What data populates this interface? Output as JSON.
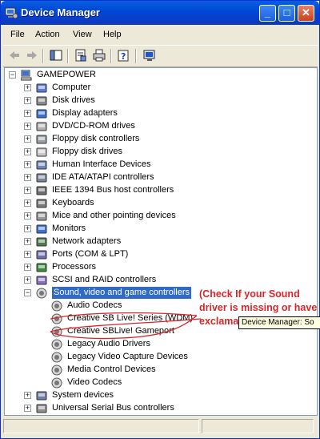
{
  "window": {
    "title": "Device Manager",
    "controls": [
      "_",
      "□",
      "✕"
    ]
  },
  "menu": [
    "File",
    "Action",
    "View",
    "Help"
  ],
  "toolbar": {
    "icons": [
      "back-icon",
      "forward-icon",
      "show-hide-console-tree-icon",
      "properties-icon",
      "print-icon",
      "help-icon",
      "scan-hardware-icon"
    ]
  },
  "tree": {
    "root": "GAMEPOWER",
    "categories": [
      "Computer",
      "Disk drives",
      "Display adapters",
      "DVD/CD-ROM drives",
      "Floppy disk controllers",
      "Floppy disk drives",
      "Human Interface Devices",
      "IDE ATA/ATAPI controllers",
      "IEEE 1394 Bus host controllers",
      "Keyboards",
      "Mice and other pointing devices",
      "Monitors",
      "Network adapters",
      "Ports (COM & LPT)",
      "Processors",
      "SCSI and RAID controllers"
    ],
    "expanded": "Sound, video and game controllers",
    "children": [
      "Audio Codecs",
      "Creative SB Live! Series (WDM)",
      "Creative SBLive! Gameport",
      "Legacy Audio Drivers",
      "Legacy Video Capture Devices",
      "Media Control Devices",
      "Video Codecs"
    ],
    "after": [
      "System devices",
      "Universal Serial Bus controllers"
    ]
  },
  "annotation": {
    "note": "(Check If your Sound driver is missing or have exclamation Mark)",
    "tooltip": "Device Manager: So"
  },
  "colors": {
    "titlebar": "#0a5fde",
    "selection": "#316ac5",
    "annotation": "#d7262a"
  }
}
